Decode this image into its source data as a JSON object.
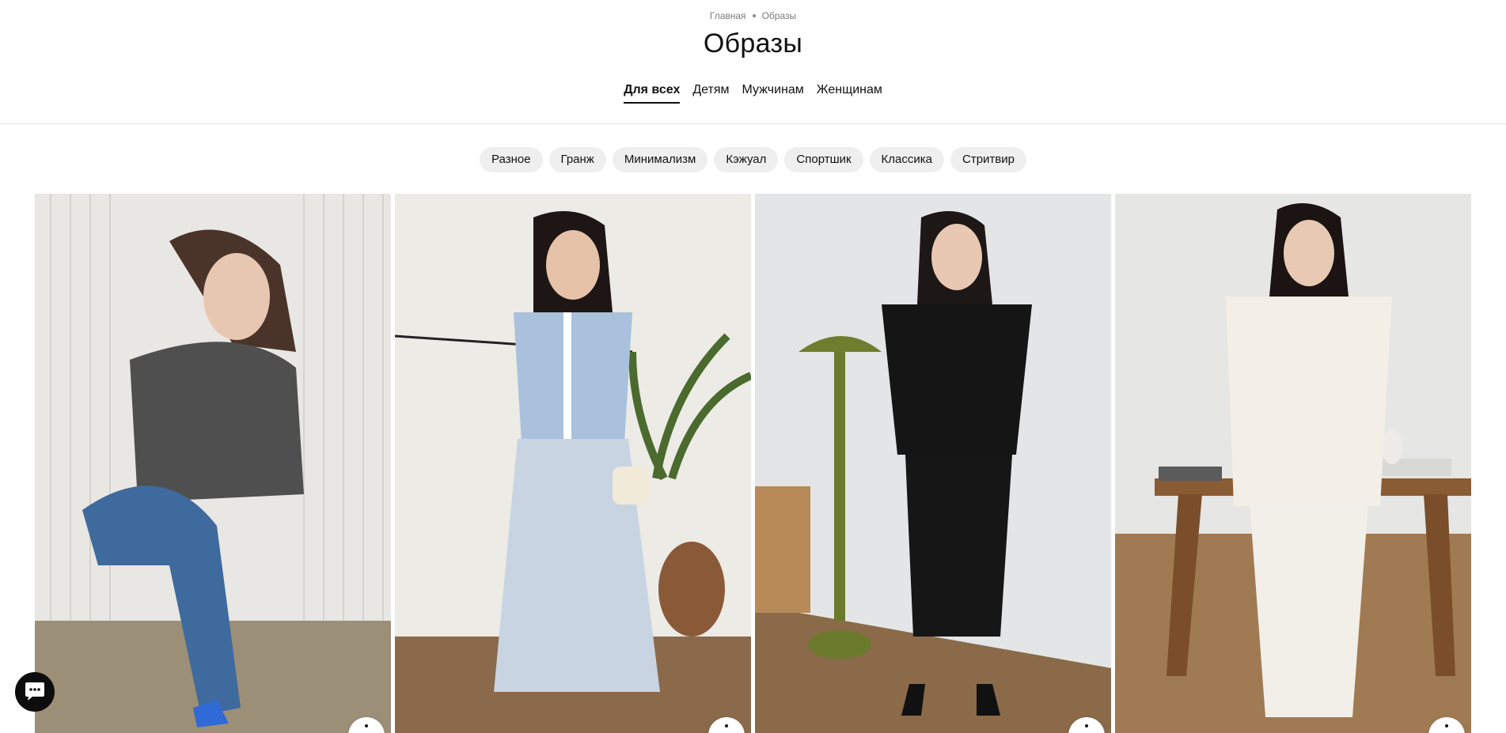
{
  "breadcrumb": {
    "home": "Главная",
    "current": "Образы"
  },
  "page": {
    "title": "Образы"
  },
  "tabs": [
    {
      "label": "Для всех",
      "active": true
    },
    {
      "label": "Детям",
      "active": false
    },
    {
      "label": "Мужчинам",
      "active": false
    },
    {
      "label": "Женщинам",
      "active": false
    }
  ],
  "styles": [
    {
      "label": "Разное"
    },
    {
      "label": "Гранж"
    },
    {
      "label": "Минимализм"
    },
    {
      "label": "Кэжуал"
    },
    {
      "label": "Спортшик"
    },
    {
      "label": "Классика"
    },
    {
      "label": "Стритвир"
    }
  ],
  "looks": [
    {
      "scene": "grey t-shirt and blue jeans"
    },
    {
      "scene": "light blue knit pleated dress"
    },
    {
      "scene": "black blouse and cropped trousers"
    },
    {
      "scene": "white shirt and white trousers"
    }
  ],
  "icons": {
    "chat": "chat-icon",
    "more": "more-icon"
  },
  "colors": {
    "accent": "#111111",
    "chip_bg": "#efefef",
    "divider": "#e6e6e6"
  }
}
